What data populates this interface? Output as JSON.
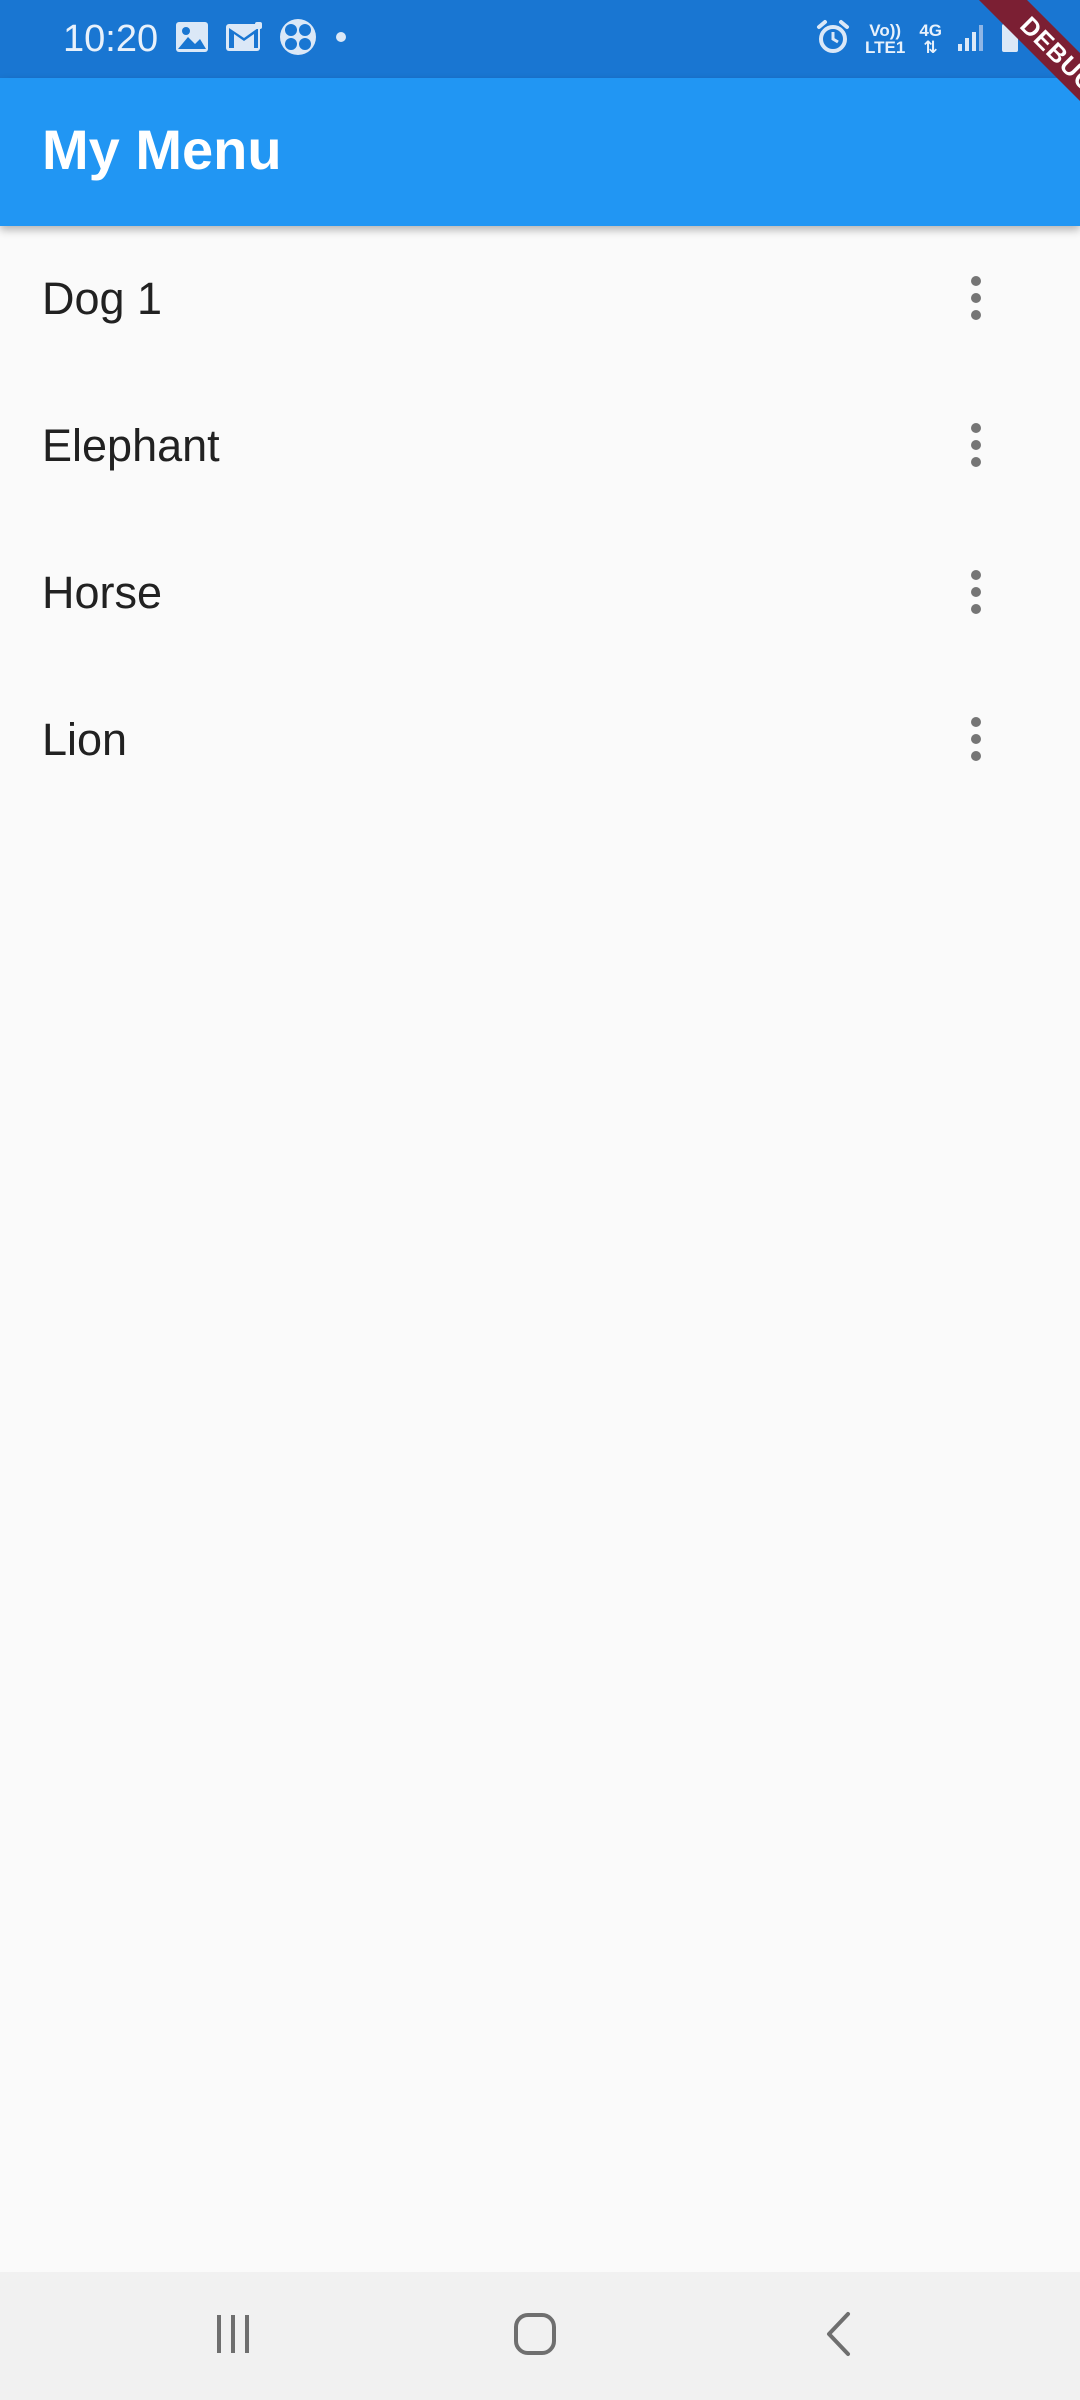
{
  "status_bar": {
    "time": "10:20",
    "volte_label": "Vo))",
    "lte_label": "LTE1",
    "network_label": "4G",
    "icons": [
      "gallery-icon",
      "gmail-icon",
      "fan-icon",
      "dot-icon",
      "alarm-icon",
      "signal-icon",
      "battery-icon"
    ]
  },
  "app_bar": {
    "title": "My Menu"
  },
  "debug_banner": {
    "label": "DEBUG"
  },
  "list": {
    "items": [
      {
        "label": "Dog 1"
      },
      {
        "label": "Elephant"
      },
      {
        "label": "Horse"
      },
      {
        "label": "Lion"
      }
    ]
  },
  "nav_bar": {
    "icons": [
      "recent-apps-icon",
      "home-icon",
      "back-icon"
    ]
  },
  "colors": {
    "status_bar": "#1976d2",
    "app_bar": "#2196f3",
    "background": "#fafafa",
    "debug_banner": "#7b1f33",
    "text": "#212121",
    "icon_gray": "#757575"
  }
}
